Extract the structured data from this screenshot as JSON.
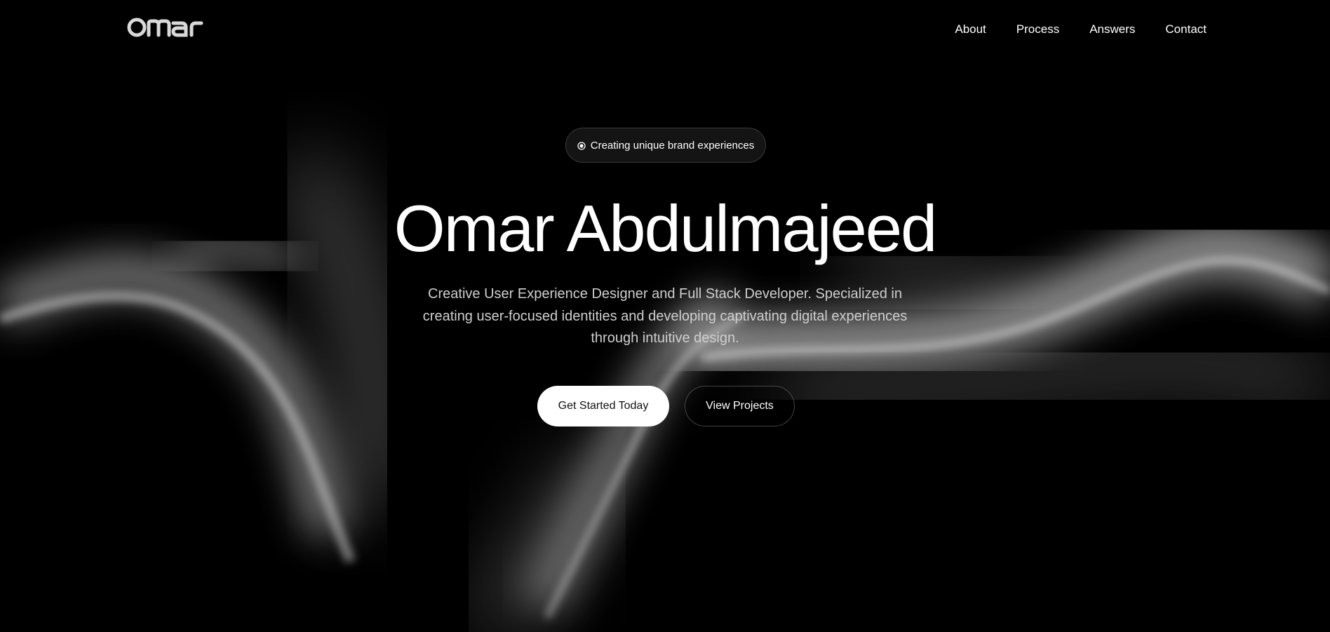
{
  "brand": {
    "logo_text": "Omar"
  },
  "nav": {
    "links": [
      {
        "label": "About"
      },
      {
        "label": "Process"
      },
      {
        "label": "Answers"
      },
      {
        "label": "Contact"
      }
    ]
  },
  "hero": {
    "badge_text": "Creating unique brand experiences",
    "badge_icon": "radio-target-icon",
    "title": "Omar Abdulmajeed",
    "description": "Creative User Experience Designer and Full Stack Developer. Specialized in creating user-focused identities and developing captivating digital experiences through intuitive design.",
    "primary_cta": "Get Started Today",
    "secondary_cta": "View Projects"
  },
  "colors": {
    "background": "#000000",
    "text": "#ffffff",
    "muted_text": "#cfcfcf",
    "primary_button_bg": "#ffffff",
    "primary_button_text": "#111111"
  }
}
